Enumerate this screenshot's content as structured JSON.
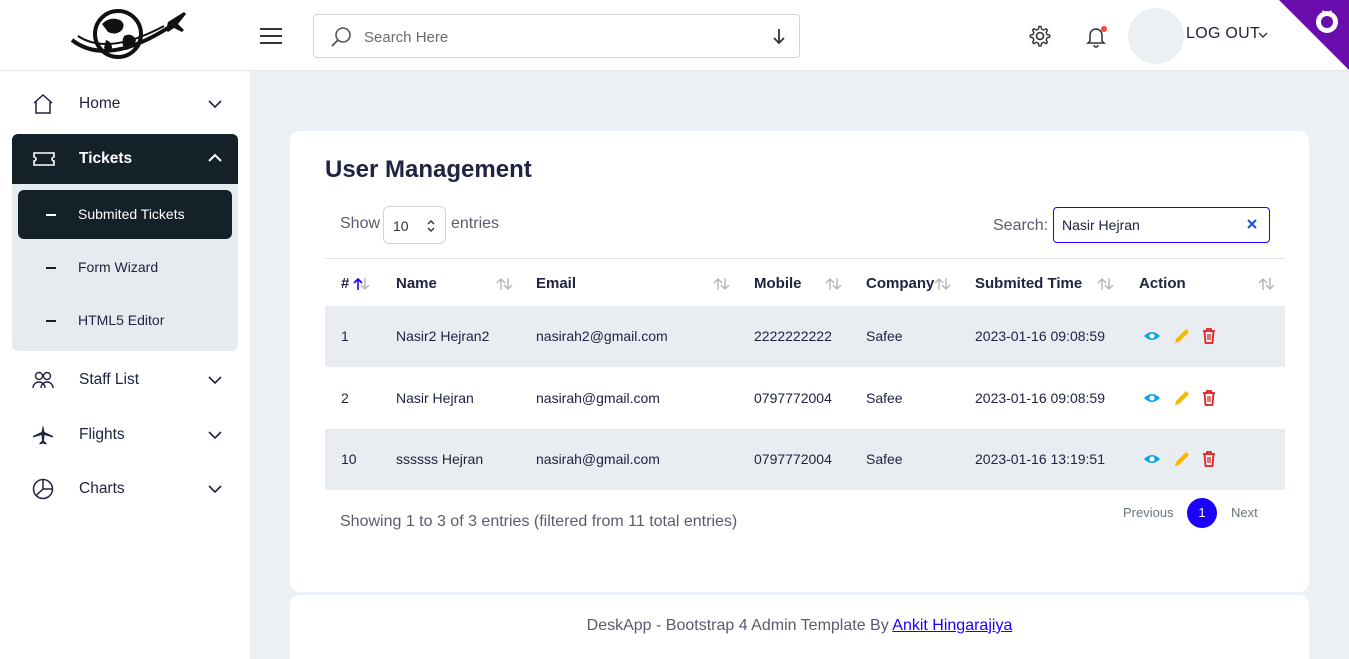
{
  "header": {
    "search_placeholder": "Search Here",
    "logout_label": "LOG OUT"
  },
  "sidebar": {
    "home": "Home",
    "tickets": "Tickets",
    "sub_items": [
      "Submited Tickets",
      "Form Wizard",
      "HTML5 Editor"
    ],
    "staff_list": "Staff List",
    "flights": "Flights",
    "charts": "Charts"
  },
  "card": {
    "title": "User Management",
    "show_label": "Show",
    "page_length": "10",
    "entries_label": "entries",
    "search_label": "Search:",
    "search_value": "Nasir Hejran",
    "columns": [
      "#",
      "Name",
      "Email",
      "Mobile",
      "Company",
      "Submited Time",
      "Action"
    ],
    "rows": [
      {
        "id": "1",
        "name": "Nasir2 Hejran2",
        "email": "nasirah2@gmail.com",
        "mobile": "2222222222",
        "company": "Safee",
        "time": "2023-01-16 09:08:59"
      },
      {
        "id": "2",
        "name": "Nasir Hejran",
        "email": "nasirah@gmail.com",
        "mobile": "0797772004",
        "company": "Safee",
        "time": "2023-01-16 09:08:59"
      },
      {
        "id": "10",
        "name": "ssssss Hejran",
        "email": "nasirah@gmail.com",
        "mobile": "0797772004",
        "company": "Safee",
        "time": "2023-01-16 13:19:51"
      }
    ],
    "info": "Showing 1 to 3 of 3 entries (filtered from 11 total entries)",
    "pagination": {
      "previous": "Previous",
      "current": "1",
      "next": "Next"
    }
  },
  "footer": {
    "text": "DeskApp - Bootstrap 4 Admin Template By ",
    "link": "Ankit Hingarajiya"
  },
  "colors": {
    "accent": "#1b00ff",
    "dark": "#142129",
    "edit": "#f5b800",
    "delete": "#e02020",
    "view": "#0ea5e9"
  }
}
